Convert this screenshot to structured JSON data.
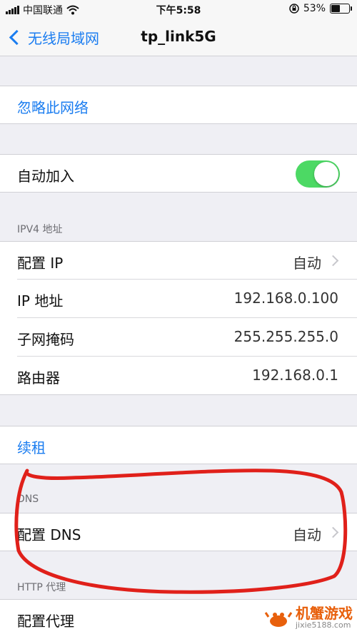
{
  "status_bar": {
    "carrier": "中国联通",
    "time": "下午5:58",
    "battery_percent": "53%",
    "battery_level": 0.53
  },
  "nav": {
    "back_label": "无线局域网",
    "title": "tp_link5G"
  },
  "forget": {
    "label": "忽略此网络"
  },
  "auto_join": {
    "label": "自动加入",
    "enabled": true
  },
  "ipv4": {
    "header": "IPV4 地址",
    "rows": [
      {
        "label": "配置 IP",
        "value": "自动"
      },
      {
        "label": "IP 地址",
        "value": "192.168.0.100"
      },
      {
        "label": "子网掩码",
        "value": "255.255.255.0"
      },
      {
        "label": "路由器",
        "value": "192.168.0.1"
      }
    ]
  },
  "renew": {
    "label": "续租"
  },
  "dns": {
    "header": "DNS",
    "row": {
      "label": "配置 DNS",
      "value": "自动"
    }
  },
  "http_proxy": {
    "header": "HTTP 代理",
    "row": {
      "label": "配置代理"
    }
  },
  "watermark": {
    "brand": "机蟹游戏",
    "site": "jixie5188.com"
  },
  "colors": {
    "accent": "#1b7df0",
    "toggle_on": "#4cd964",
    "annotation": "#e0201a",
    "background": "#efeff4"
  },
  "icons": [
    "signal-icon",
    "wifi-icon",
    "lock-rotation-icon",
    "battery-icon",
    "back-chevron-icon",
    "disclosure-chevron-icon"
  ]
}
